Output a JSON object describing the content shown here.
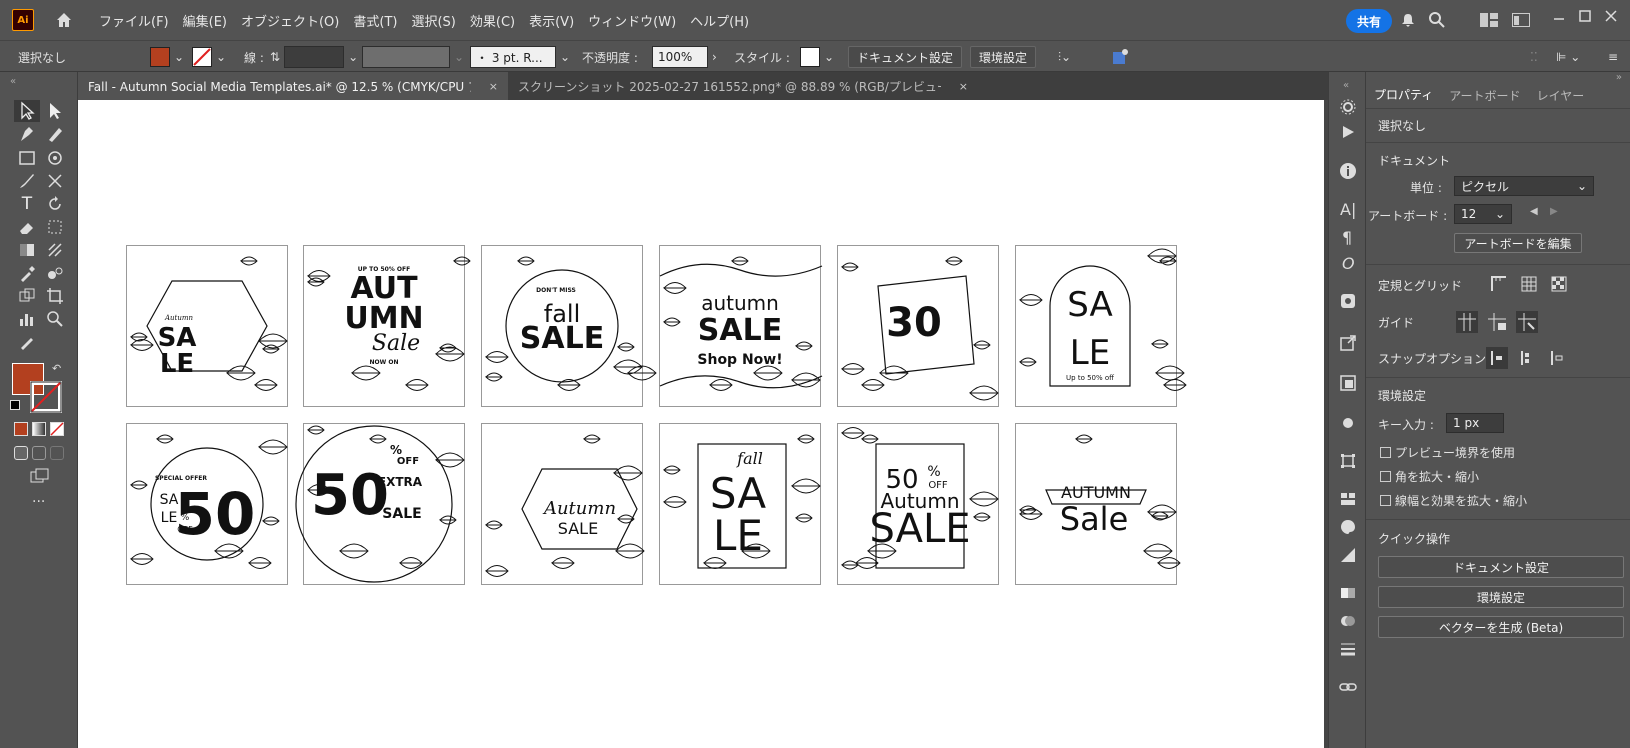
{
  "app": {
    "logo": "Ai"
  },
  "menu": [
    "ファイル(F)",
    "編集(E)",
    "オブジェクト(O)",
    "書式(T)",
    "選択(S)",
    "効果(C)",
    "表示(V)",
    "ウィンドウ(W)",
    "ヘルプ(H)"
  ],
  "share_label": "共有",
  "control": {
    "selection": "選択なし",
    "stroke_label": "線 :",
    "brush": "・ 3 pt. R...",
    "opacity_label": "不透明度 :",
    "opacity_value": "100%",
    "style_label": "スタイル :",
    "doc_setup": "ドキュメント設定",
    "preferences": "環境設定"
  },
  "tabs": [
    {
      "label": "Fall - Autumn Social Media Templates.ai* @ 12.5 % (CMYK/CPU アウトライン)",
      "close": "×"
    },
    {
      "label": "スクリーンショット 2025-02-27 161552.png* @ 88.89 % (RGB/プレビュー)",
      "close": "×"
    }
  ],
  "colors": {
    "fill": "#b3401f",
    "accent": "#1473e6",
    "stroke_none": "#e02020"
  },
  "panel": {
    "tabs": [
      "プロパティ",
      "アートボード",
      "レイヤー"
    ],
    "no_selection": "選択なし",
    "document_title": "ドキュメント",
    "unit_label": "単位 :",
    "unit_value": "ピクセル",
    "artboard_label": "アートボード :",
    "artboard_value": "12",
    "edit_artboards": "アートボードを編集",
    "rulers_grid": "定規とグリッド",
    "guides": "ガイド",
    "snap_options": "スナップオプション",
    "preferences_title": "環境設定",
    "key_input_label": "キー入力 :",
    "key_input_value": "1 px",
    "check_preview_bounds": "プレビュー境界を使用",
    "check_scale_corners": "角を拡大・縮小",
    "check_scale_strokes": "線幅と効果を拡大・縮小",
    "quick_actions": "クイック操作",
    "qa_doc_setup": "ドキュメント設定",
    "qa_preferences": "環境設定",
    "qa_vectorize": "ベクターを生成 (Beta)"
  },
  "artboards": [
    {
      "lines": [
        "Autumn",
        "SA",
        "LE"
      ]
    },
    {
      "lines": [
        "UP TO 50% OFF",
        "AUT",
        "UMN",
        "Sale",
        "NOW ON"
      ]
    },
    {
      "lines": [
        "DON'T MISS",
        "fall",
        "SALE"
      ]
    },
    {
      "lines": [
        "autumn",
        "SALE",
        "Shop Now!"
      ]
    },
    {
      "lines": [
        "30"
      ]
    },
    {
      "lines": [
        "SA",
        "LE",
        "Up to 50% off"
      ]
    },
    {
      "lines": [
        "SPECIAL OFFER",
        "SA",
        "LE",
        "50",
        "%",
        "OFF"
      ]
    },
    {
      "lines": [
        "50",
        "%",
        "OFF",
        "EXTRA",
        "SALE"
      ]
    },
    {
      "lines": [
        "Autumn",
        "SALE"
      ]
    },
    {
      "lines": [
        "fall",
        "SA",
        "LE"
      ]
    },
    {
      "lines": [
        "50",
        "%",
        "OFF",
        "Autumn",
        "SALE"
      ]
    },
    {
      "lines": [
        "AUTUMN",
        "Sale"
      ]
    }
  ]
}
